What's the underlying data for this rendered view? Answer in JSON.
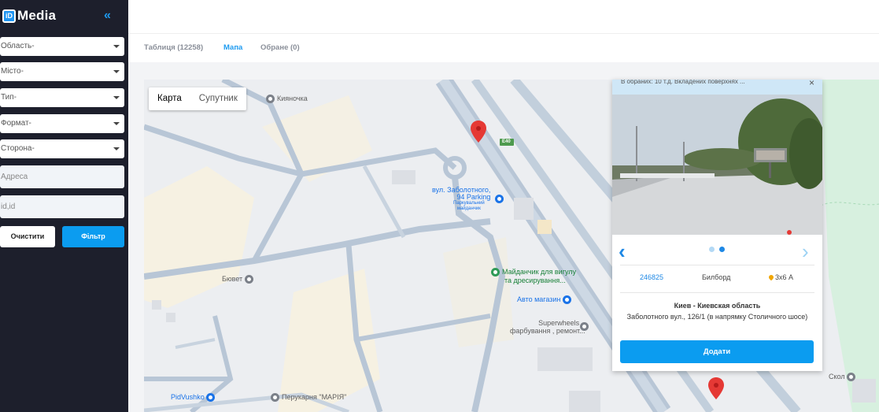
{
  "brand": {
    "logo_badge": "iD",
    "name": "Media"
  },
  "sidebar": {
    "collapse_icon": "«",
    "selects": [
      {
        "placeholder": "Область-"
      },
      {
        "placeholder": "Місто-"
      },
      {
        "placeholder": "Тип-"
      },
      {
        "placeholder": "Формат-"
      },
      {
        "placeholder": "Сторона-"
      }
    ],
    "inputs": [
      {
        "placeholder": "Адреса"
      },
      {
        "placeholder": "id,id"
      }
    ],
    "clear_label": "Очистити",
    "filter_label": "Фільтр"
  },
  "tabs": [
    {
      "label": "Таблиця (12258)",
      "active": false
    },
    {
      "label": "Мапа",
      "active": true
    },
    {
      "label": "Обране (0)",
      "active": false
    }
  ],
  "map": {
    "type_buttons": [
      "Карта",
      "Супутник"
    ],
    "road_label": "E40",
    "pois": [
      {
        "label": "Кияночка"
      },
      {
        "label": "вул. Заболотного,"
      },
      {
        "label": "94 Parking"
      },
      {
        "label": "Паркувальний"
      },
      {
        "label": "майданчик"
      },
      {
        "label": "Майданчик для вигулу"
      },
      {
        "label": "та дресирування..."
      },
      {
        "label": "Бювет"
      },
      {
        "label": "Авто магазин"
      },
      {
        "label": "Superwheels –"
      },
      {
        "label": "фарбування , ремонт..."
      },
      {
        "label": "PidVushko"
      },
      {
        "label": "Перукарня \"МАРІЯ\""
      },
      {
        "label": "Скол"
      }
    ]
  },
  "popup": {
    "header": "В обраних: 10 т.д. Вкладених поверхнях ...",
    "close_icon": "×",
    "id": "246825",
    "type": "Билборд",
    "size": "3х6 А",
    "region": "Киев - Киевская область",
    "address": "Заболотного вул., 126/1 (в напрямку Столичного шосе)",
    "add_label": "Додати",
    "slides_total": 2,
    "slide_active": 2
  },
  "colors": {
    "accent": "#0b9cf0",
    "sidebar_bg": "#1d1f2c",
    "marker": "#e53935"
  }
}
